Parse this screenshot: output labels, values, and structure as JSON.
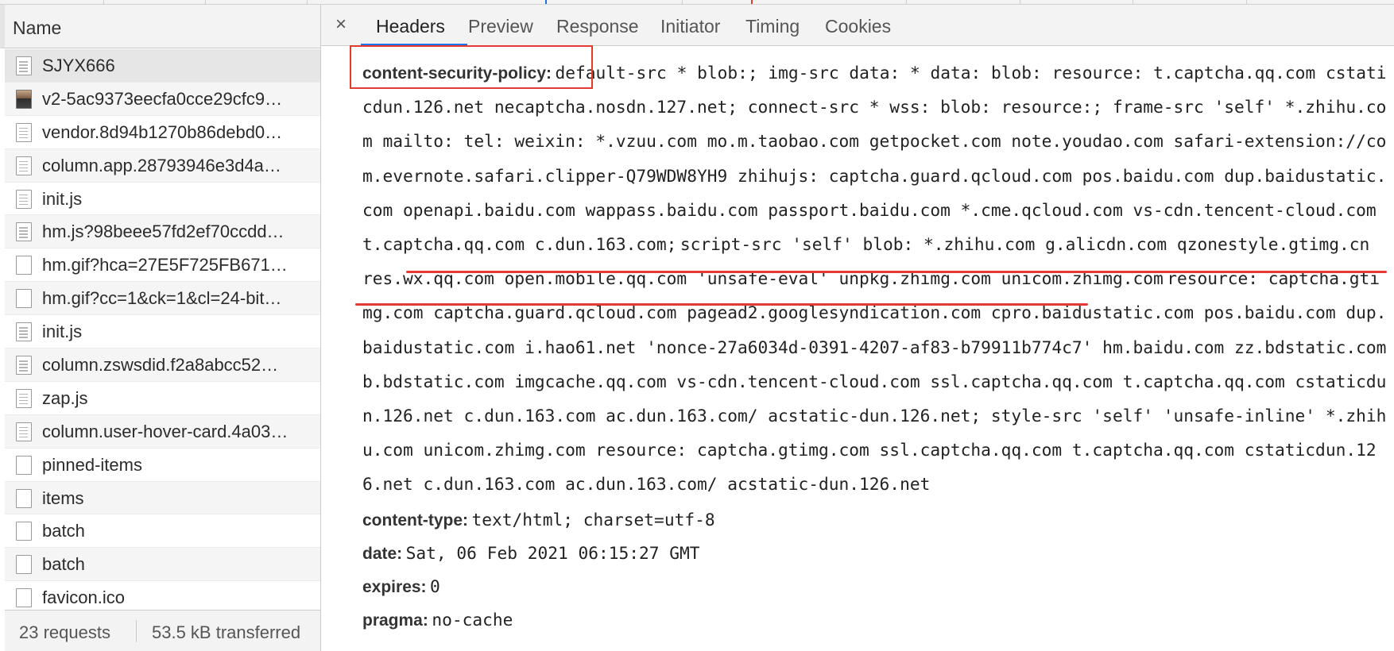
{
  "colors": {
    "accent": "#1a73e8",
    "annotation": "#e53935",
    "panel_bg": "#f3f3f3",
    "selected_row": "#e6e6e6"
  },
  "network_list": {
    "column_header": "Name",
    "requests": [
      {
        "name": "SJYX666",
        "icon": "document-icon"
      },
      {
        "name": "v2-5ac9373eecfa0cce29cfc9…",
        "icon": "image-thumbnail-icon"
      },
      {
        "name": "vendor.8d94b1270b86debd0…",
        "icon": "script-icon"
      },
      {
        "name": "column.app.28793946e3d4a…",
        "icon": "script-icon"
      },
      {
        "name": "init.js",
        "icon": "script-icon"
      },
      {
        "name": "hm.js?98beee57fd2ef70ccdd…",
        "icon": "script-icon"
      },
      {
        "name": "hm.gif?hca=27E5F725FB671…",
        "icon": "blank-file-icon"
      },
      {
        "name": "hm.gif?cc=1&ck=1&cl=24-bit…",
        "icon": "blank-file-icon"
      },
      {
        "name": "init.js",
        "icon": "script-icon"
      },
      {
        "name": "column.zswsdid.f2a8abcc52…",
        "icon": "script-icon"
      },
      {
        "name": "zap.js",
        "icon": "script-icon"
      },
      {
        "name": "column.user-hover-card.4a03…",
        "icon": "script-icon"
      },
      {
        "name": "pinned-items",
        "icon": "blank-file-icon"
      },
      {
        "name": "items",
        "icon": "blank-file-icon"
      },
      {
        "name": "batch",
        "icon": "blank-file-icon"
      },
      {
        "name": "batch",
        "icon": "blank-file-icon"
      },
      {
        "name": "favicon.ico",
        "icon": "blank-file-icon"
      }
    ],
    "status": {
      "requests": "23 requests",
      "transferred": "53.5 kB transferred"
    }
  },
  "detail": {
    "close_label": "×",
    "tabs": [
      "Headers",
      "Preview",
      "Response",
      "Initiator",
      "Timing",
      "Cookies"
    ],
    "active_tab": "Headers",
    "csp": {
      "name": "content-security-policy:",
      "value_before": "default-src * blob:; img-src data: * data: blob: resource: t.captcha.qq.com cstaticdun.126.net necaptcha.nosdn.127.net; connect-src * wss: blob: resource:; frame-src 'self' *.zhihu.com mailto: tel: weixin: *.vzuu.com mo.m.taobao.com getpocket.com note.youdao.com safari-extension://com.evernote.safari.clipper-Q79WDW8YH9 zhihujs: captcha.guard.qcloud.com pos.baidu.com dup.baidustatic.com openapi.baidu.com wappass.baidu.com passport.baidu.com *.cme.qcloud.com vs-cdn.tencent-cloud.com t.captcha.qq.com c.dun.163.com;",
      "value_highlight": "script-src 'self' blob: *.zhihu.com g.alicdn.com qzonestyle.gtimg.cn res.wx.qq.com open.mobile.qq.com 'unsafe-eval' unpkg.zhimg.com unicom.zhimg.com",
      "value_after": "resource: captcha.gtimg.com captcha.guard.qcloud.com pagead2.googlesyndication.com cpro.baidustatic.com pos.baidu.com dup.baidustatic.com i.hao61.net 'nonce-27a6034d-0391-4207-af83-b79911b774c7' hm.baidu.com zz.bdstatic.com b.bdstatic.com imgcache.qq.com vs-cdn.tencent-cloud.com ssl.captcha.qq.com t.captcha.qq.com cstaticdun.126.net c.dun.163.com ac.dun.163.com/ acstatic-dun.126.net; style-src 'self' 'unsafe-inline' *.zhihu.com unicom.zhimg.com resource: captcha.gtimg.com ssl.captcha.qq.com t.captcha.qq.com cstaticdun.126.net c.dun.163.com ac.dun.163.com/ acstatic-dun.126.net"
    },
    "headers": [
      {
        "name": "content-type:",
        "value": "text/html; charset=utf-8"
      },
      {
        "name": "date:",
        "value": "Sat, 06 Feb 2021 06:15:27 GMT"
      },
      {
        "name": "expires:",
        "value": "0"
      },
      {
        "name": "pragma:",
        "value": "no-cache"
      }
    ]
  }
}
